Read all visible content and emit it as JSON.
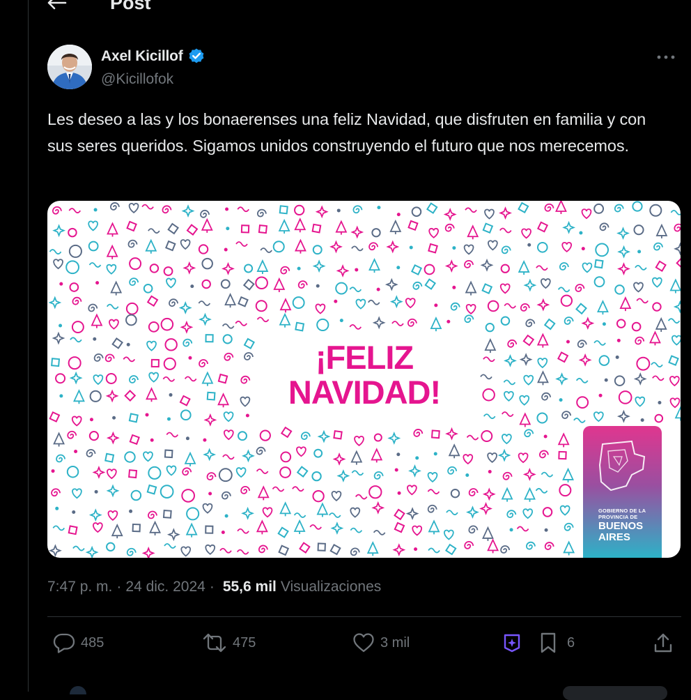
{
  "header": {
    "title": "Post",
    "back_icon": "arrow-left-icon"
  },
  "author": {
    "name": "Axel Kicillof",
    "handle": "@Kicillofok",
    "verified_icon": "verified-badge-icon",
    "verified_color": "#1d9bf0",
    "more_icon": "more-horizontal-icon"
  },
  "post": {
    "text": "Les deseo a las y los bonaerenses una feliz Navidad, que disfruten en familia y con sus seres queridos. Sigamos unidos construyendo el futuro que nos merecemos."
  },
  "media": {
    "greeting_line1": "¡FELIZ",
    "greeting_line2": "NAVIDAD!",
    "badge_small_line1": "GOBIERNO DE LA",
    "badge_small_line2": "PROVINCIA DE",
    "badge_big_line1": "BUENOS",
    "badge_big_line2": "AIRES",
    "colors": {
      "pink": "#e5158f",
      "teal": "#2db2c7",
      "slate": "#5a6b86"
    }
  },
  "meta": {
    "time": "7:47 p. m.",
    "separator": "·",
    "date": "24 dic. 2024",
    "separator2": "·",
    "views_count": "55,6 mil",
    "views_label": "Visualizaciones"
  },
  "actions": {
    "replies": {
      "icon": "reply-icon",
      "count": "485"
    },
    "reposts": {
      "icon": "repost-icon",
      "count": "475"
    },
    "likes": {
      "icon": "heart-icon",
      "count": "3 mil"
    },
    "grok": {
      "icon": "grok-icon",
      "color": "#7856ff"
    },
    "bookmarks": {
      "icon": "bookmark-icon",
      "count": "6"
    },
    "share": {
      "icon": "share-icon"
    }
  }
}
